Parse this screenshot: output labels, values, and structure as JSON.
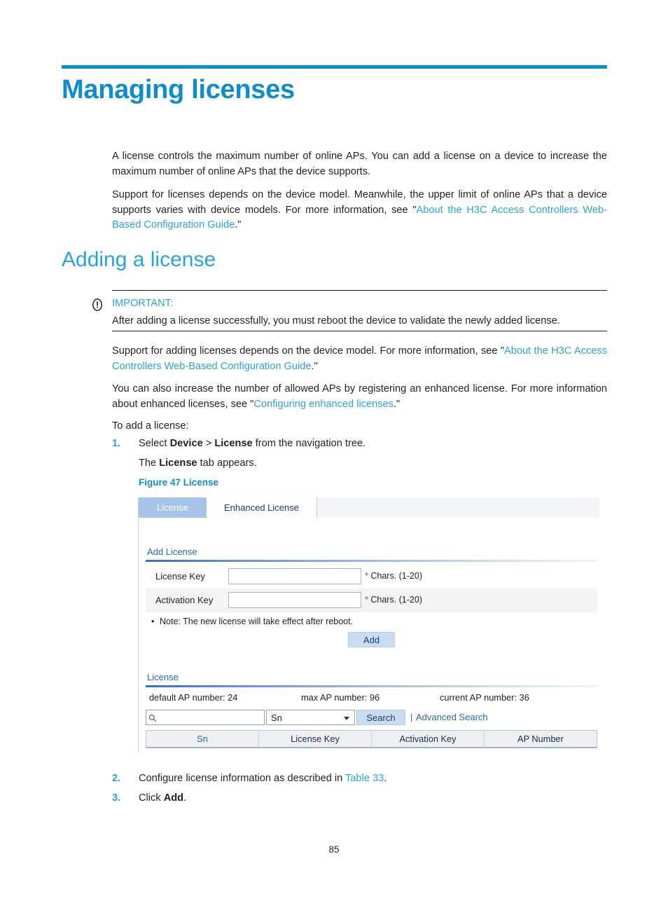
{
  "document": {
    "page_number": "85",
    "heading1": "Managing licenses",
    "heading2": "Adding a license",
    "paragraph1": "A license controls the maximum number of online APs. You can add a license on a device to increase the maximum number of online APs that the device supports.",
    "paragraph2_part1": "Support for licenses depends on the device model. Meanwhile, the upper limit of online APs that a device supports varies with device models. For more information, see \"",
    "paragraph2_link": "About the H3C Access Controllers Web-Based Configuration Guide",
    "paragraph2_part2": ".\"",
    "note": {
      "icon": "exclamation-circle-icon",
      "title": "IMPORTANT:",
      "text": "After adding a license successfully, you must reboot the device to validate the newly added license."
    },
    "paragraph3_part1": "Support for adding licenses depends on the device model. For more information, see \"",
    "paragraph3_link": "About the H3C Access Controllers Web-Based Configuration Guide",
    "paragraph3_part2": ".\"",
    "paragraph4_part1": "You can also increase the number of allowed APs by registering an enhanced license. For more information about enhanced licenses, see \"",
    "paragraph4_link": "Configuring enhanced licenses",
    "paragraph4_part2": ".\"",
    "paragraph5": "To add a license:",
    "steps": [
      {
        "number": "1.",
        "text_part1": "Select ",
        "bold1": "Device",
        "text_part2": " > ",
        "bold2": "License",
        "text_part3": " from the navigation tree.",
        "substep_part1": "The ",
        "substep_bold": "License",
        "substep_part2": " tab appears."
      },
      {
        "number": "2.",
        "text_part1": "Configure license information as described in ",
        "link": "Table 33",
        "text_part2": "."
      },
      {
        "number": "3.",
        "text_part1": "Click ",
        "bold1": "Add",
        "text_part2": "."
      }
    ],
    "figure_caption": "Figure 47 License"
  },
  "screenshot": {
    "tabs": [
      {
        "label": "License",
        "active": true
      },
      {
        "label": "Enhanced License",
        "active": false
      }
    ],
    "add_license_section": {
      "title": "Add License",
      "fields": [
        {
          "label": "License Key",
          "value": "",
          "placeholder": "",
          "requirement_star": "*",
          "requirement_text": " Chars. (1-20)"
        },
        {
          "label": "Activation Key",
          "value": "",
          "placeholder": "",
          "requirement_star": "*",
          "requirement_text": " Chars. (1-20)"
        }
      ],
      "note": "Note: The new license will take effect after reboot.",
      "add_button": "Add"
    },
    "license_section": {
      "title": "License",
      "stats": [
        "default AP number: 24",
        "max AP number: 96",
        "current AP number: 36"
      ],
      "search": {
        "input_value": "",
        "input_placeholder": "",
        "search_icon": "magnifier-icon",
        "select_value": "Sn",
        "select_options": [
          "Sn",
          "License Key",
          "Activation Key",
          "AP Number"
        ],
        "search_button": "Search",
        "separator": "|",
        "advanced_search": "Advanced Search"
      },
      "table": {
        "columns": [
          {
            "label": "Sn",
            "sorted": true
          },
          {
            "label": "License Key",
            "sorted": false
          },
          {
            "label": "Activation Key",
            "sorted": false
          },
          {
            "label": "AP Number",
            "sorted": false
          }
        ],
        "rows": []
      }
    }
  }
}
